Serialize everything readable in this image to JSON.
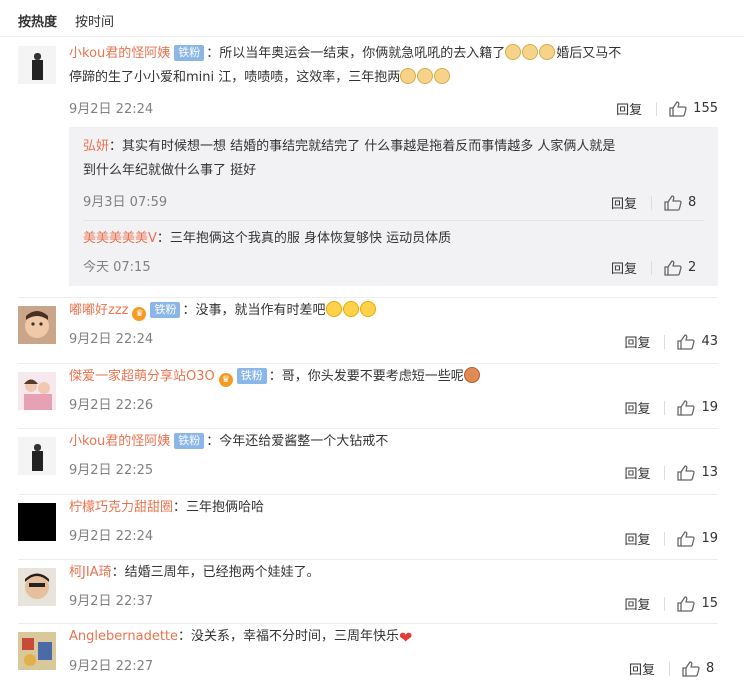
{
  "tabs": {
    "hot": "按热度",
    "time": "按时间"
  },
  "reply_label": "回复",
  "comments": [
    {
      "user": "小kou君的怪阿姨",
      "badge": "铁粉",
      "text1": "：所以当年奥运会一结束，你俩就急吼吼的去入籍了",
      "text2": "婚后又马不",
      "text3": "停蹄的生了小小爱和mini 江，啧啧啧，这效率，三年抱两",
      "time": "9月2日 22:24",
      "likes": "155",
      "replies": [
        {
          "user": "弘妍",
          "text": "：其实有时候想一想 结婚的事结完就结完了 什么事越是拖着反而事情越多 人家俩人就是",
          "text2": "到什么年纪就做什么事了 挺好",
          "time": "9月3日 07:59",
          "likes": "8"
        },
        {
          "user": "美美美美美V",
          "text": "：三年抱俩这个我真的服 身体恢复够快 运动员体质",
          "time": "今天 07:15",
          "likes": "2"
        }
      ]
    },
    {
      "user": "嘟嘟好zzz",
      "badge": "铁粉",
      "text": "：没事，就当作有时差吧",
      "time": "9月2日 22:24",
      "likes": "43"
    },
    {
      "user": "傑爱一家超萌分享站O3O",
      "badge": "铁粉",
      "text": "：哥，你头发要不要考虑短一些呢",
      "time": "9月2日 22:26",
      "likes": "19"
    },
    {
      "user": "小kou君的怪阿姨",
      "badge": "铁粉",
      "text": "：今年还给爱酱整一个大钻戒不",
      "time": "9月2日 22:25",
      "likes": "13"
    },
    {
      "user": "柠檬巧克力甜甜圈",
      "text": "：三年抱俩哈哈",
      "time": "9月2日 22:24",
      "likes": "19"
    },
    {
      "user": "柯JIA琦",
      "text": "：结婚三周年，已经抱两个娃娃了。",
      "time": "9月2日 22:37",
      "likes": "15"
    },
    {
      "user": "Anglebernadette",
      "text": "：没关系，幸福不分时间，三周年快乐",
      "time": "9月2日 22:27",
      "likes": "8"
    }
  ]
}
